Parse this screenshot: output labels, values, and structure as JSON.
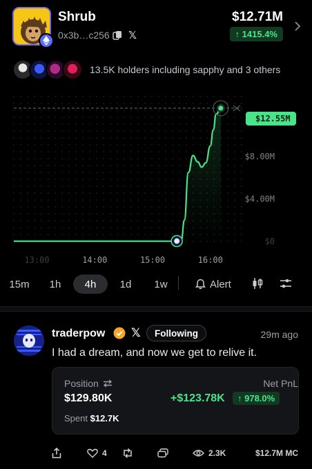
{
  "token": {
    "name": "Shrub",
    "address": "0x3b…c256",
    "price": "$12.71M",
    "change": "↑ 1415.4%",
    "colors": {
      "accent_green": "#4be38a",
      "badge_bg": "#123a22"
    }
  },
  "holders": {
    "text": "13.5K holders including sapphy and 3 others",
    "avatar_count": 4
  },
  "chart_data": {
    "type": "line",
    "x_ticks": [
      "13:00",
      "14:00",
      "15:00",
      "16:00"
    ],
    "y_ticks": [
      "$0",
      "$4.00M",
      "$8.00M"
    ],
    "current_value_label": "$12.55M",
    "ylim": [
      0,
      13000000
    ],
    "grid": true,
    "series": [
      {
        "x": [
          12.6,
          13.0,
          13.5,
          14.0,
          14.5,
          15.0,
          15.3,
          15.42,
          15.5,
          15.55,
          15.62,
          15.7,
          15.78,
          15.85,
          15.92,
          16.0,
          16.05,
          16.1,
          16.18
        ],
        "y": [
          20000,
          20000,
          20000,
          20000,
          20000,
          20000,
          20000,
          30000,
          200000,
          2000000,
          6500000,
          8100000,
          7500000,
          7000000,
          7400000,
          9000000,
          10500000,
          12000000,
          12550000
        ]
      }
    ],
    "markers": [
      {
        "x": 15.42,
        "y": 30000,
        "kind": "trade"
      },
      {
        "x": 16.18,
        "y": 12550000,
        "kind": "current"
      }
    ]
  },
  "timeframes": {
    "items": [
      "15m",
      "1h",
      "4h",
      "1d",
      "1w"
    ],
    "active": "4h",
    "alert_label": "Alert"
  },
  "post": {
    "username": "traderpow",
    "x_glyph": "𝕏",
    "follow_label": "Following",
    "time_ago": "29m ago",
    "text": "I had a dream, and now we get to relive it.",
    "trade": {
      "position_label": "Position",
      "position_value": "$129.80K",
      "spent_label": "Spent",
      "spent_value": "$12.7K",
      "pnl_label": "Net PnL",
      "pnl_value": "+$123.78K",
      "pnl_percent": "↑ 978.0%"
    },
    "actions": {
      "likes": "4",
      "views": "2.3K",
      "market_cap": "$12.7M MC"
    }
  }
}
